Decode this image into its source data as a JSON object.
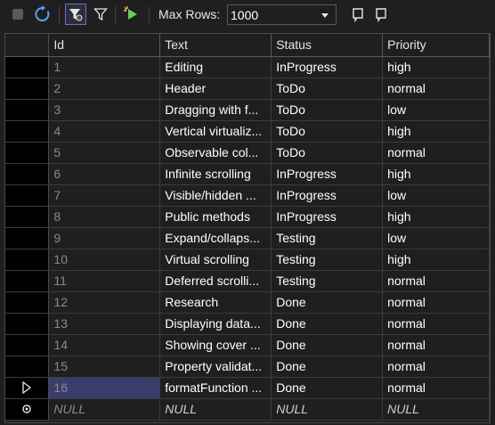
{
  "toolbar": {
    "max_rows_label": "Max Rows:",
    "max_rows_value": "1000",
    "icons": [
      "stop-icon",
      "refresh-icon",
      "filter-active-icon",
      "filter-icon",
      "run-query-icon",
      "script-icon",
      "script-alt-icon"
    ]
  },
  "columns": [
    "Id",
    "Text",
    "Status",
    "Priority"
  ],
  "rows": [
    {
      "id": "1",
      "text": "Editing",
      "status": "InProgress",
      "priority": "high"
    },
    {
      "id": "2",
      "text": "Header",
      "status": "ToDo",
      "priority": "normal"
    },
    {
      "id": "3",
      "text": "Dragging with f...",
      "status": "ToDo",
      "priority": "low"
    },
    {
      "id": "4",
      "text": "Vertical virtualiz...",
      "status": "ToDo",
      "priority": "high"
    },
    {
      "id": "5",
      "text": "Observable col...",
      "status": "ToDo",
      "priority": "normal"
    },
    {
      "id": "6",
      "text": "Infinite scrolling",
      "status": "InProgress",
      "priority": "high"
    },
    {
      "id": "7",
      "text": "Visible/hidden ...",
      "status": "InProgress",
      "priority": "low"
    },
    {
      "id": "8",
      "text": "Public methods",
      "status": "InProgress",
      "priority": "high"
    },
    {
      "id": "9",
      "text": "Expand/collaps...",
      "status": "Testing",
      "priority": "low"
    },
    {
      "id": "10",
      "text": "Virtual scrolling",
      "status": "Testing",
      "priority": "high"
    },
    {
      "id": "11",
      "text": "Deferred scrolli...",
      "status": "Testing",
      "priority": "normal"
    },
    {
      "id": "12",
      "text": "Research",
      "status": "Done",
      "priority": "normal"
    },
    {
      "id": "13",
      "text": "Displaying data...",
      "status": "Done",
      "priority": "normal"
    },
    {
      "id": "14",
      "text": "Showing cover ...",
      "status": "Done",
      "priority": "normal"
    },
    {
      "id": "15",
      "text": "Property validat...",
      "status": "Done",
      "priority": "normal"
    },
    {
      "id": "16",
      "text": "formatFunction ...",
      "status": "Done",
      "priority": "normal"
    }
  ],
  "new_row": {
    "id": "NULL",
    "text": "NULL",
    "status": "NULL",
    "priority": "NULL"
  },
  "colors": {
    "accent": "#3a3d6b",
    "background": "#1f1f1f"
  }
}
